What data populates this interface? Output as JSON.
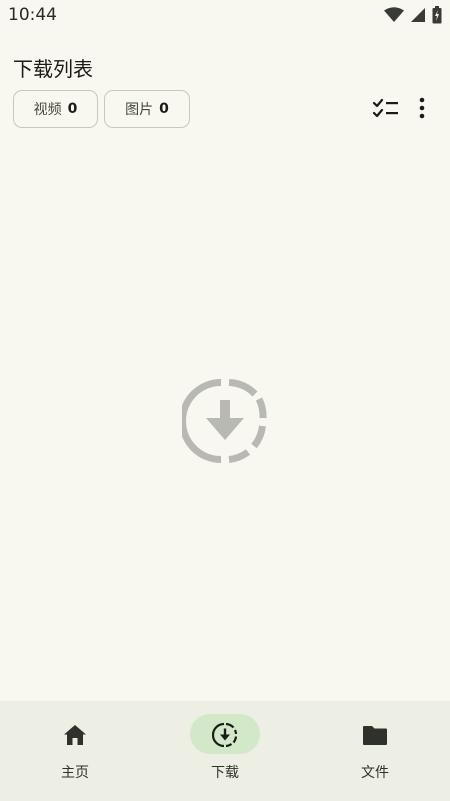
{
  "status_bar": {
    "time": "10:44",
    "icons": [
      "wifi-icon",
      "signal-icon",
      "battery-charging-icon"
    ]
  },
  "header": {
    "title": "下载列表"
  },
  "filters": [
    {
      "label": "视频",
      "count": "0",
      "icon": "none"
    },
    {
      "label": "图片",
      "count": "0",
      "icon": "none"
    }
  ],
  "toolbar": {
    "icons": [
      "checklist-icon",
      "more-vert-icon"
    ]
  },
  "empty_state": {
    "icon": "download-circle-dashed-icon"
  },
  "bottom_nav": {
    "items": [
      {
        "label": "主页",
        "icon": "home-icon",
        "selected": false
      },
      {
        "label": "下载",
        "icon": "download-circle-icon",
        "selected": true
      },
      {
        "label": "文件",
        "icon": "folder-icon",
        "selected": false
      }
    ]
  },
  "colors": {
    "background": "#f8f8f0",
    "nav_background": "#edefe5",
    "nav_indicator": "#d3e8c8",
    "empty_icon": "#b8b9b3"
  }
}
